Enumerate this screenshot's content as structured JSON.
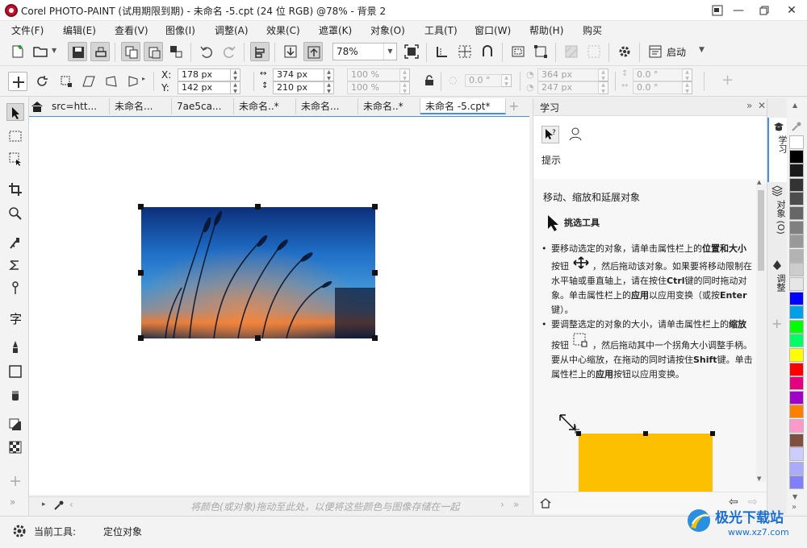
{
  "window": {
    "title": "Corel PHOTO-PAINT (试用期限到期) - 未命名 -5.cpt (24 位 RGB) @78% - 背景 2",
    "icon": "corel-app-icon"
  },
  "menu": [
    "文件(F)",
    "编辑(E)",
    "查看(V)",
    "图像(I)",
    "调整(A)",
    "效果(C)",
    "遮罩(K)",
    "对象(O)",
    "工具(T)",
    "窗口(W)",
    "帮助(H)",
    "购买"
  ],
  "toolbar": {
    "zoom_value": "78%",
    "launch_label": "启动"
  },
  "propbar": {
    "x_label": "X:",
    "y_label": "Y:",
    "x_value": "178 px",
    "y_value": "142 px",
    "w_value": "374 px",
    "h_value": "210 px",
    "scale_x": "100 %",
    "scale_y": "100 %",
    "rotate": "0.0 °",
    "cx": "364 px",
    "cy": "247 px",
    "skew_x": "0.0 °",
    "skew_y": "0.0 °"
  },
  "doc_tabs": [
    "src=htt...",
    "未命名...",
    "7ae5ca...",
    "未命名..*",
    "未命名...",
    "未命名..*",
    "未命名 -5.cpt*"
  ],
  "color_tray": {
    "hint": "将颜色(或对象)拖动至此处，以便将这些颜色与图像存储在一起"
  },
  "learn_panel": {
    "title": "学习",
    "hint_label": "提示",
    "heading": "移动、缩放和延展对象",
    "tool_name": "挑选工具",
    "bullet1": {
      "part1": "要移动选定的对象，请单击属性栏上的",
      "bold1": "位置和大小",
      "part2": "按钮",
      "part3": "，然后拖动该对象。如果要将移动限制在水平轴或垂直轴上，请在按住",
      "bold2": "Ctrl",
      "part4": "键的同时拖动对象。单击属性栏上的",
      "bold3": "应用",
      "part5": "以应用变换（或按",
      "bold4": "Enter",
      "part6": "键）。"
    },
    "bullet2": {
      "part1": "要调整选定的对象的大小，请单击属性栏上的",
      "bold1": "缩放",
      "part2": "按钮",
      "part3": "，然后拖动其中一个拐角大小调整手柄。要从中心缩放，在拖动的同时请按住",
      "bold2": "Shift",
      "part4": "键。单击属性栏上的",
      "bold3": "应用",
      "part5": "按钮以应用变换。"
    },
    "illustration_color": "#fcc000"
  },
  "side_tabs": [
    "学习",
    "对象 (O)",
    "调整"
  ],
  "palette": [
    "#ffffff",
    "#000000",
    "#1a1a1a",
    "#333333",
    "#4d4d4d",
    "#666666",
    "#808080",
    "#999999",
    "#b3b3b3",
    "#cccccc",
    "#e6e6e6",
    "#0000ff",
    "#00a0e9",
    "#00ff00",
    "#00ff66",
    "#ffff00",
    "#ff0000",
    "#e4007f",
    "#a000c8",
    "#ff8000",
    "#ff99cc",
    "#7f4f3f",
    "#ccccff",
    "#aaaaff",
    "#8080ff"
  ],
  "status": {
    "current_tool_label": "当前工具:",
    "current_tool_value": "定位对象"
  },
  "watermark": {
    "brand": "极光下载站",
    "url": "www.xz7.com"
  }
}
